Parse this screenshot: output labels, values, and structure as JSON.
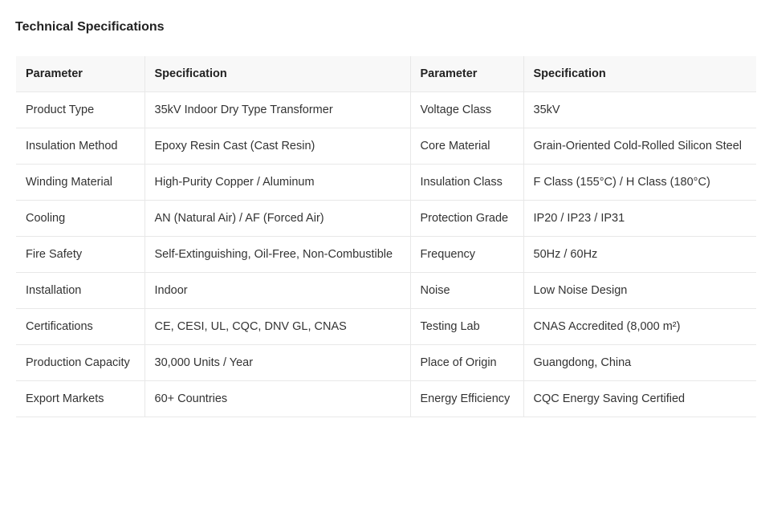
{
  "title": "Technical Specifications",
  "headers": [
    "Parameter",
    "Specification",
    "Parameter",
    "Specification"
  ],
  "rows": [
    [
      "Product Type",
      "35kV Indoor Dry Type Transformer",
      "Voltage Class",
      "35kV"
    ],
    [
      "Insulation Method",
      "Epoxy Resin Cast (Cast Resin)",
      "Core Material",
      "Grain-Oriented Cold-Rolled Silicon Steel"
    ],
    [
      "Winding Material",
      "High-Purity Copper / Aluminum",
      "Insulation Class",
      "F Class (155°C) / H Class (180°C)"
    ],
    [
      "Cooling",
      "AN (Natural Air) / AF (Forced Air)",
      "Protection Grade",
      "IP20 / IP23 / IP31"
    ],
    [
      "Fire Safety",
      "Self-Extinguishing, Oil-Free, Non-Combustible",
      "Frequency",
      "50Hz / 60Hz"
    ],
    [
      "Installation",
      "Indoor",
      "Noise",
      "Low Noise Design"
    ],
    [
      "Certifications",
      "CE, CESI, UL, CQC, DNV GL, CNAS",
      "Testing Lab",
      "CNAS Accredited (8,000 m²)"
    ],
    [
      "Production Capacity",
      "30,000 Units / Year",
      "Place of Origin",
      "Guangdong, China"
    ],
    [
      "Export Markets",
      "60+ Countries",
      "Energy Efficiency",
      "CQC Energy Saving Certified"
    ]
  ]
}
